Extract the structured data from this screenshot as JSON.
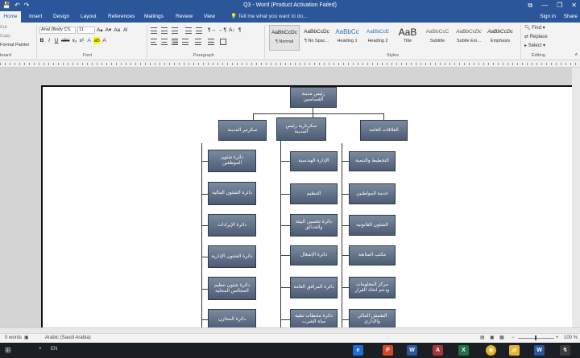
{
  "window": {
    "title": "Q3 - Word (Product Activation Failed)",
    "quick_access": [
      "💾",
      "↶",
      "↷"
    ],
    "controls": [
      "⧉",
      "—",
      "❐",
      "✕"
    ]
  },
  "tabs": [
    "Home",
    "Insert",
    "Design",
    "Layout",
    "References",
    "Mailings",
    "Review",
    "View"
  ],
  "tell_me": "💡 Tell me what you want to do...",
  "sign_in": "Sign in",
  "share": "Share",
  "clipboard": {
    "cut": "Cut",
    "copy": "Copy",
    "format_painter": "Format Painter",
    "group_label": "board"
  },
  "font": {
    "name": "Arial (Body CS",
    "size": "11",
    "group_label": "Font"
  },
  "paragraph": {
    "group_label": "Paragraph"
  },
  "styles": {
    "group_label": "Styles",
    "items": [
      {
        "preview": "AaBbCcDc",
        "name": "¶ Normal"
      },
      {
        "preview": "AaBbCcDc",
        "name": "¶ No Spac..."
      },
      {
        "preview": "AaBbCc",
        "name": "Heading 1"
      },
      {
        "preview": "AaBbCcE",
        "name": "Heading 2"
      },
      {
        "preview": "AaB",
        "name": "Title"
      },
      {
        "preview": "AaBbCcC",
        "name": "Subtitle"
      },
      {
        "preview": "AaBbCcDc",
        "name": "Subtle Em..."
      },
      {
        "preview": "AaBbCcDc",
        "name": "Emphasis"
      }
    ]
  },
  "editing": {
    "find": "Find",
    "replace": "Replace",
    "select": "Select",
    "group_label": "Editing"
  },
  "org_chart": {
    "root": "رئيس مدينة القصاصين",
    "level1": [
      "العلاقات العامة",
      "سكرتارية رئيس المدينة",
      "سكرتير المدينة"
    ],
    "col_right": [
      "التخطيط والتنمية",
      "خدمة المواطنين",
      "الشئون القانونية",
      "مكتب المتابعة",
      "مركز المعلومات ودعم اتخاذ القرار",
      "التفتيش المالي والإداري"
    ],
    "col_mid": [
      "الإدارة الهندسية",
      "التنظيم",
      "دائرة تحسين البيئة والحدائق",
      "دائرة الإشغال",
      "دائرة المرافق العامة",
      "دائرة محطات تنقية مياه الشرب"
    ],
    "col_left": [
      "دائرة شئون الموظفين",
      "دائرة الشئون المالية",
      "دائرة الإيرادات",
      "دائرة الشئون الإدارية",
      "دائرة شئون تنظيم المجالس المحلية",
      "دائرة المخازن"
    ]
  },
  "status": {
    "words": "0 words",
    "language": "Arabic (Saudi Arabia)",
    "zoom": "100 %"
  },
  "taskbar": {
    "lang": "EN",
    "apps": [
      "e",
      "P",
      "W",
      "A",
      "X",
      "◉",
      "📁",
      "W",
      "↯"
    ]
  }
}
